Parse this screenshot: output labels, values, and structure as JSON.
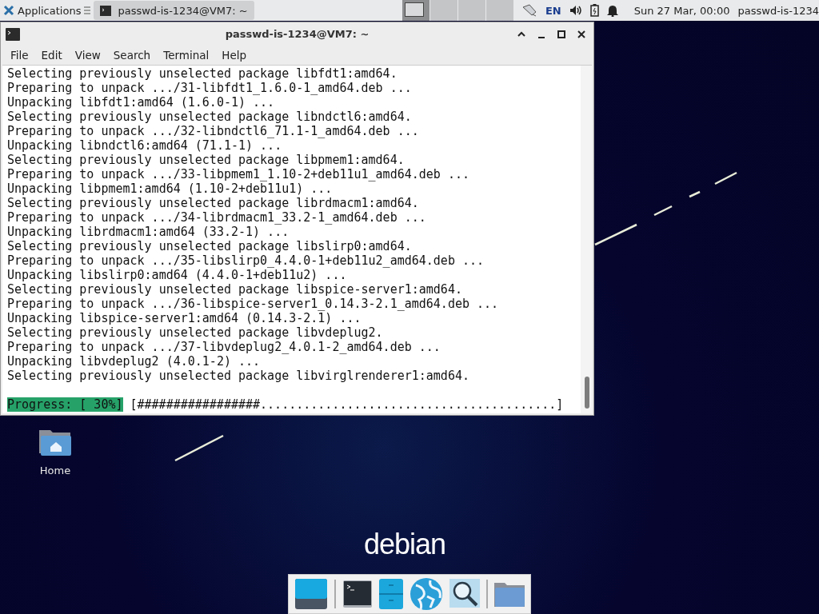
{
  "top_panel": {
    "applications_menu": {
      "label": "Applications"
    },
    "tasks": [
      {
        "label": "passwd-is-1234@VM7: ~",
        "selected": true
      }
    ],
    "workspaces": [
      {
        "selected": true
      },
      {
        "selected": false
      },
      {
        "selected": false
      },
      {
        "selected": false
      }
    ],
    "keyboard_layout": "EN",
    "clock": "Sun 27 Mar, 00:00",
    "user": "passwd-is-1234"
  },
  "terminal": {
    "title": "passwd-is-1234@VM7: ~",
    "menu": [
      "File",
      "Edit",
      "View",
      "Search",
      "Terminal",
      "Help"
    ],
    "lines": [
      "Selecting previously unselected package libfdt1:amd64.",
      "Preparing to unpack .../31-libfdt1_1.6.0-1_amd64.deb ...",
      "Unpacking libfdt1:amd64 (1.6.0-1) ...",
      "Selecting previously unselected package libndctl6:amd64.",
      "Preparing to unpack .../32-libndctl6_71.1-1_amd64.deb ...",
      "Unpacking libndctl6:amd64 (71.1-1) ...",
      "Selecting previously unselected package libpmem1:amd64.",
      "Preparing to unpack .../33-libpmem1_1.10-2+deb11u1_amd64.deb ...",
      "Unpacking libpmem1:amd64 (1.10-2+deb11u1) ...",
      "Selecting previously unselected package librdmacm1:amd64.",
      "Preparing to unpack .../34-librdmacm1_33.2-1_amd64.deb ...",
      "Unpacking librdmacm1:amd64 (33.2-1) ...",
      "Selecting previously unselected package libslirp0:amd64.",
      "Preparing to unpack .../35-libslirp0_4.4.0-1+deb11u2_amd64.deb ...",
      "Unpacking libslirp0:amd64 (4.4.0-1+deb11u2) ...",
      "Selecting previously unselected package libspice-server1:amd64.",
      "Preparing to unpack .../36-libspice-server1_0.14.3-2.1_amd64.deb ...",
      "Unpacking libspice-server1:amd64 (0.14.3-2.1) ...",
      "Selecting previously unselected package libvdeplug2.",
      "Preparing to unpack .../37-libvdeplug2_4.0.1-2_amd64.deb ...",
      "Unpacking libvdeplug2 (4.0.1-2) ...",
      "Selecting previously unselected package libvirglrenderer1:amd64."
    ],
    "progress": {
      "label": "Progress: [ 30%]",
      "bar": "[#################.........................................]"
    }
  },
  "desktop_icons": [
    {
      "label": "Home"
    }
  ],
  "logo": "debian",
  "dock": [
    {
      "kind": "desktop"
    },
    {
      "kind": "separator"
    },
    {
      "kind": "terminal"
    },
    {
      "kind": "files"
    },
    {
      "kind": "browser"
    },
    {
      "kind": "finder"
    },
    {
      "kind": "separator"
    },
    {
      "kind": "folder"
    }
  ]
}
